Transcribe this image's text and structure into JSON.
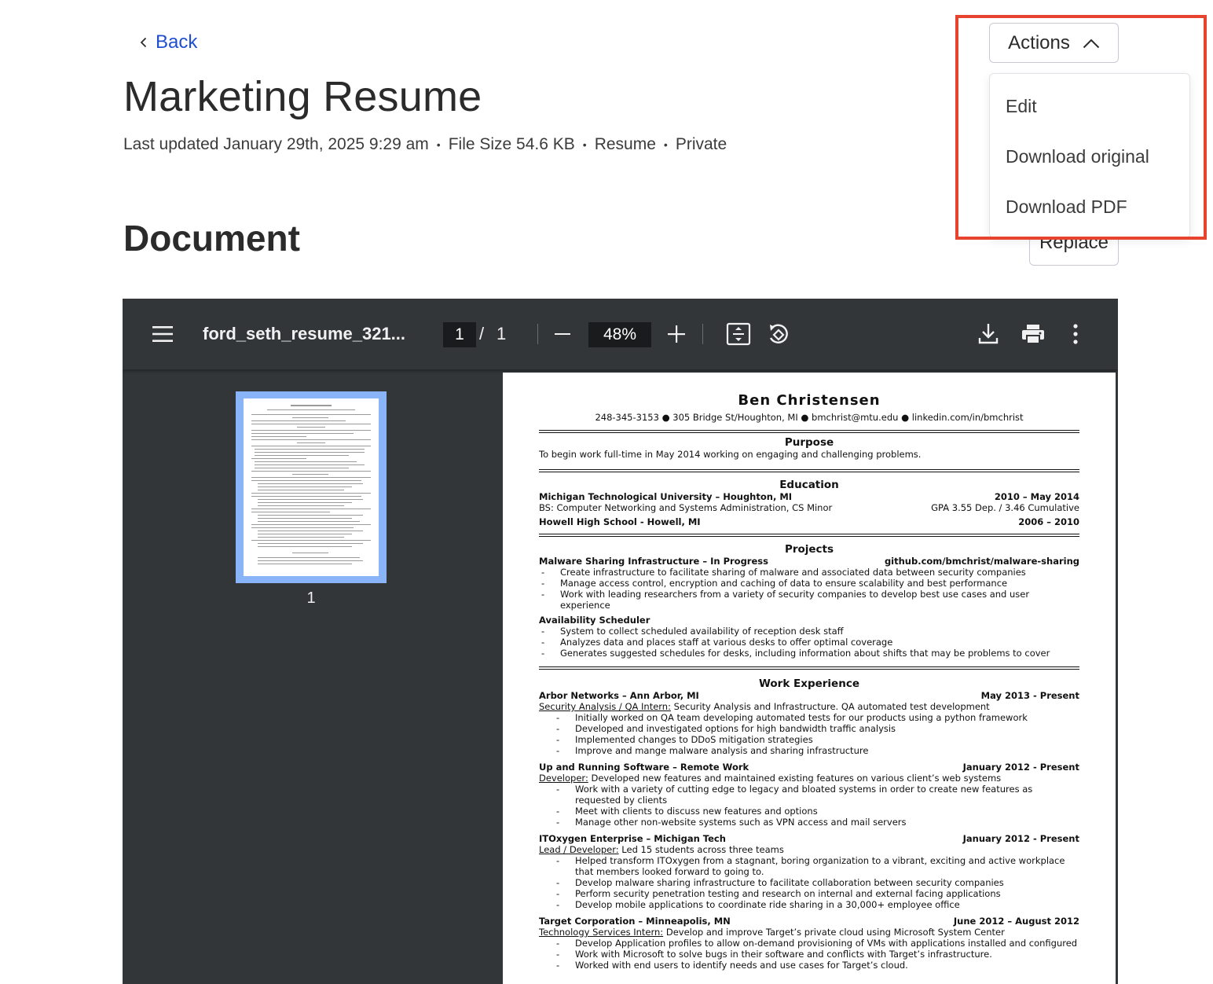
{
  "nav": {
    "back_label": "Back"
  },
  "header": {
    "title": "Marketing Resume",
    "meta": {
      "updated": "Last updated January 29th, 2025 9:29 am",
      "size": "File Size 54.6 KB",
      "type": "Resume",
      "visibility": "Private"
    }
  },
  "actions": {
    "label": "Actions",
    "menu": [
      "Edit",
      "Download original",
      "Download PDF"
    ]
  },
  "document": {
    "heading": "Document",
    "replace_label": "Replace"
  },
  "viewer": {
    "filename": "ford_seth_resume_321...",
    "page_current": "1",
    "page_separator": "/",
    "page_total": "1",
    "zoom": "48%",
    "thumbnail_label": "1",
    "highlight_color": "#e8432f",
    "thumb_border_color": "#8ab4f8"
  },
  "resume": {
    "name": "Ben Christensen",
    "contact": "248-345-3153 ● 305 Bridge St/Houghton, MI ● bmchrist@mtu.edu ● linkedin.com/in/bmchrist",
    "purpose_title": "Purpose",
    "purpose_text": "To begin work full-time in May 2014 working on engaging and challenging problems.",
    "education_title": "Education",
    "edu1_school": "Michigan Technological University – Houghton, MI",
    "edu1_dates": "2010 – May 2014",
    "edu1_degree": "BS: Computer Networking and Systems Administration, CS Minor",
    "edu1_gpa": "GPA 3.55 Dep. / 3.46 Cumulative",
    "edu2_school": "Howell High School   - Howell, MI",
    "edu2_dates": "2006 – 2010",
    "projects_title": "Projects",
    "proj1_title": "Malware Sharing Infrastructure – In Progress",
    "proj1_link": "github.com/bmchrist/malware-sharing",
    "proj1_items": [
      "Create infrastructure to facilitate sharing of malware and associated data between security companies",
      "Manage access control, encryption and caching of data to ensure scalability and best performance",
      "Work with leading researchers from a variety of security companies to develop best use cases and user experience"
    ],
    "proj2_title": "Availability Scheduler",
    "proj2_items": [
      "System to collect scheduled availability of reception desk staff",
      "Analyzes data and places staff at various desks to offer optimal coverage",
      "Generates suggested schedules for desks, including information about shifts that may be problems to cover"
    ],
    "work_title": "Work Experience",
    "jobs": [
      {
        "company": "Arbor Networks – Ann Arbor, MI",
        "dates": "May 2013 - Present",
        "role": "Security Analysis / QA Intern:",
        "desc": " Security Analysis and Infrastructure. QA automated test development",
        "items": [
          "Initially worked on QA team developing automated tests for our products using a python framework",
          "Developed and investigated options for high bandwidth traffic analysis",
          "Implemented changes to DDoS mitigation strategies",
          "Improve and mange malware analysis and sharing infrastructure"
        ]
      },
      {
        "company": "Up and Running Software – Remote Work",
        "dates": "January 2012 - Present",
        "role": "Developer:",
        "desc": " Developed new features and maintained existing features on various client’s web systems",
        "items": [
          "Work with a variety of cutting edge to legacy and bloated systems in order to create new features as requested by clients",
          "Meet with clients to discuss new features and options",
          "Manage other non-website systems such as VPN access and mail servers"
        ]
      },
      {
        "company": "ITOxygen Enterprise – Michigan Tech",
        "dates": "January 2012 - Present",
        "role": "Lead / Developer:",
        "desc": " Led 15 students across three teams",
        "items": [
          "Helped transform ITOxygen from a stagnant, boring organization to a vibrant, exciting and active workplace that members looked forward to going to.",
          "Develop malware sharing infrastructure to facilitate collaboration between security companies",
          "Perform security penetration testing and research on internal and external facing applications",
          "Develop mobile applications to coordinate ride sharing in a 30,000+ employee office"
        ]
      },
      {
        "company": "Target Corporation – Minneapolis, MN",
        "dates": "June 2012 – August 2012",
        "role": "Technology Services Intern:",
        "desc": " Develop and improve Target’s private cloud using Microsoft System Center",
        "items": [
          "Develop Application profiles to allow on-demand provisioning of VMs with applications installed and configured",
          "Work with Microsoft to solve bugs in their software and conflicts with Target’s infrastructure.",
          "Worked with end users to identify needs and use cases for Target’s cloud."
        ]
      }
    ]
  }
}
